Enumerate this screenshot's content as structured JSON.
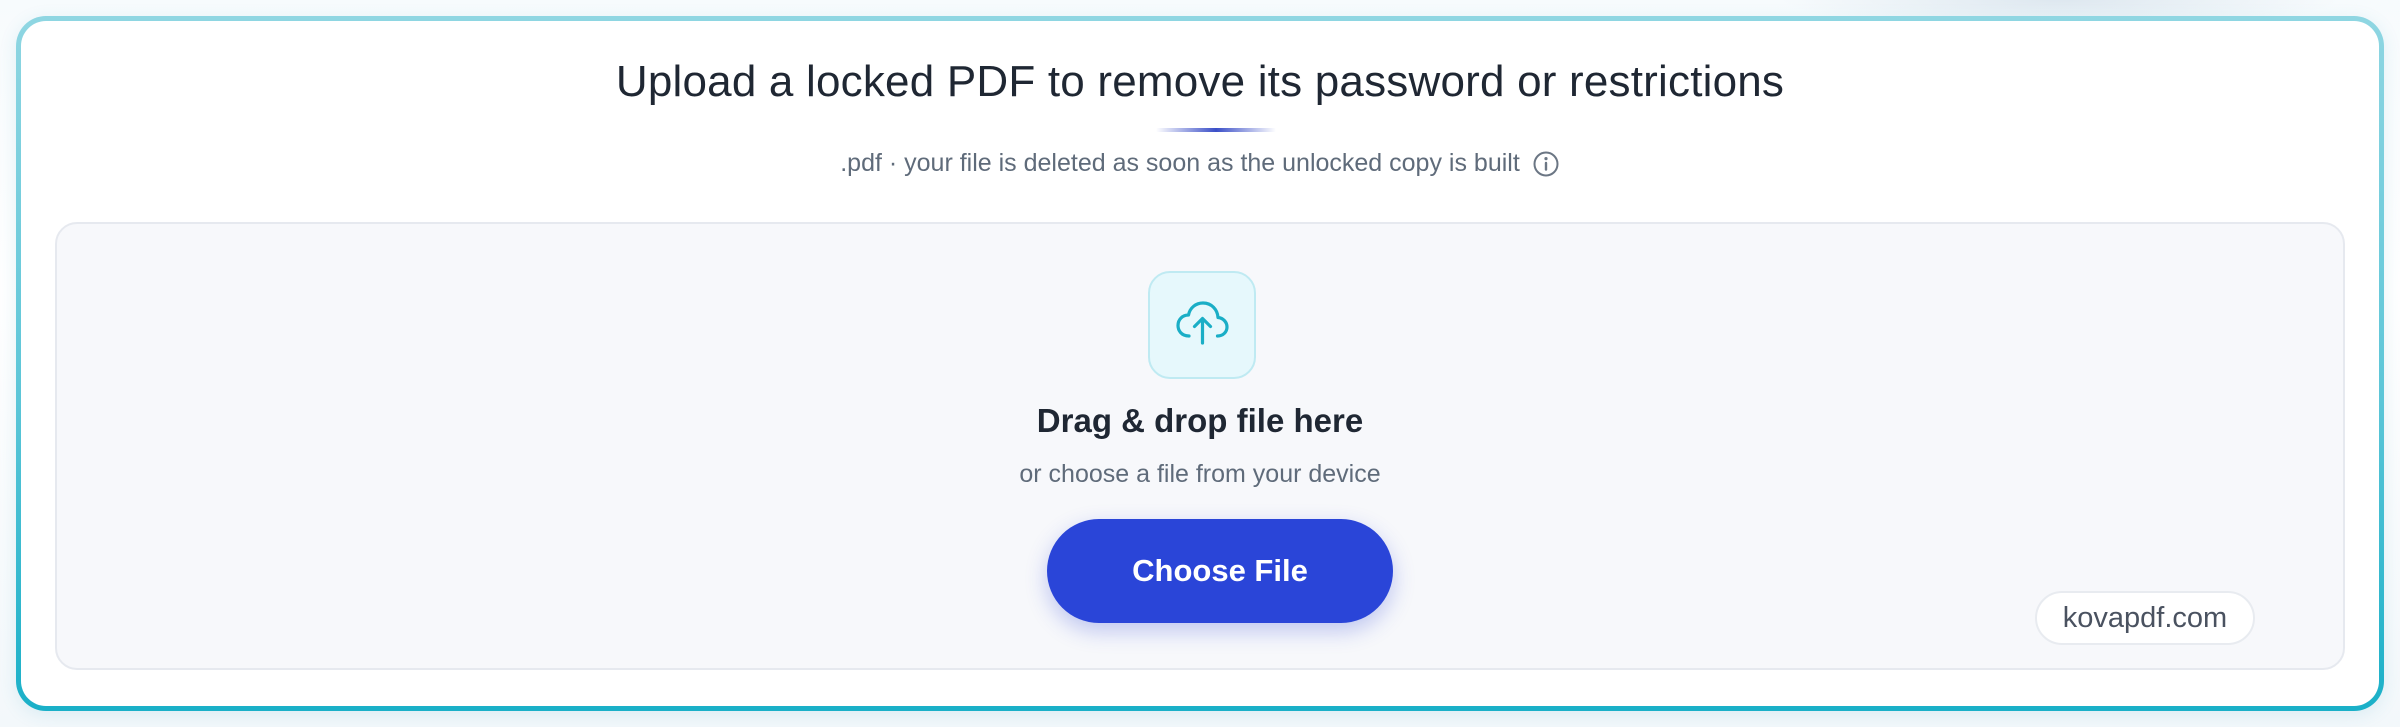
{
  "header": {
    "title": "Upload a locked PDF to remove its password or restrictions",
    "subtitle": ".pdf · your file is deleted as soon as the unlocked copy is built",
    "info_icon": "info-icon"
  },
  "dropzone": {
    "icon": "cloud-upload-icon",
    "heading": "Drag & drop file here",
    "subheading": "or choose a file from your device",
    "button_label": "Choose File"
  },
  "watermark": {
    "text": "kovapdf.com"
  },
  "colors": {
    "accent": "#2a45d8",
    "frame": "#1ab0c8",
    "icon": "#1aaec6",
    "text": "#1f2733",
    "muted": "#5f6b7a"
  }
}
